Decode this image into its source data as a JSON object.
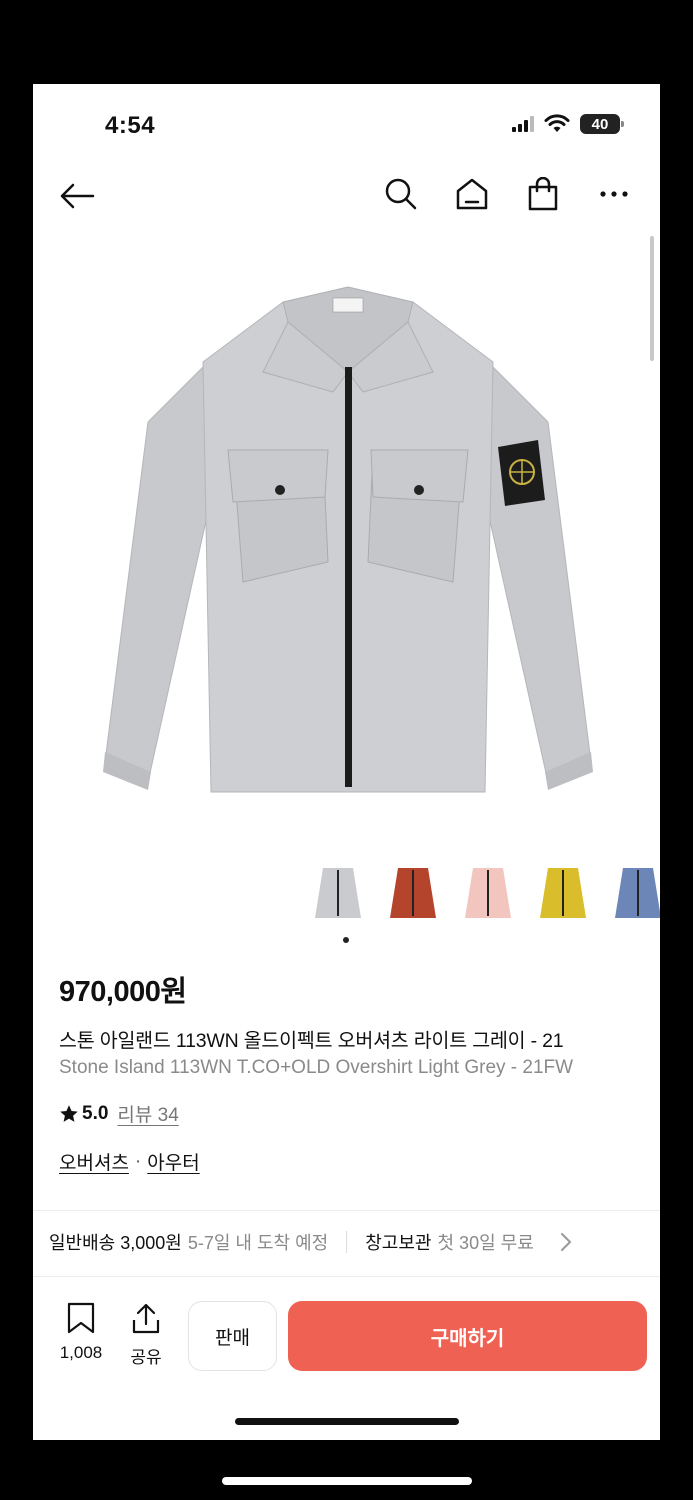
{
  "status_bar": {
    "time": "4:54",
    "battery": "40"
  },
  "nav": {
    "icons": [
      "back-arrow-icon",
      "search-icon",
      "home-icon",
      "shopping-bag-icon",
      "more-icon"
    ]
  },
  "product": {
    "thumbnail_colors": [
      "#c9cbce",
      "#b5442c",
      "#f2c6bf",
      "#d9bd2a",
      "#6d86b8"
    ],
    "price": "970,000원",
    "title_ko": "스톤 아일랜드 113WN 올드이펙트 오버셔츠 라이트 그레이 - 21",
    "title_en": "Stone Island 113WN T.CO+OLD Overshirt Light Grey - 21FW",
    "rating": "5.0",
    "reviews_label": "리뷰 34",
    "categories": [
      "오버셔츠",
      "아우터"
    ]
  },
  "shipping": {
    "label": "일반배송 3,000원",
    "eta": "5-7일 내 도착 예정",
    "storage_label": "창고보관",
    "storage_info": "첫 30일 무료"
  },
  "bottom_bar": {
    "bookmark_count": "1,008",
    "share_label": "공유",
    "sell_label": "판매",
    "buy_label": "구매하기",
    "buy_color": "#ef6253"
  }
}
